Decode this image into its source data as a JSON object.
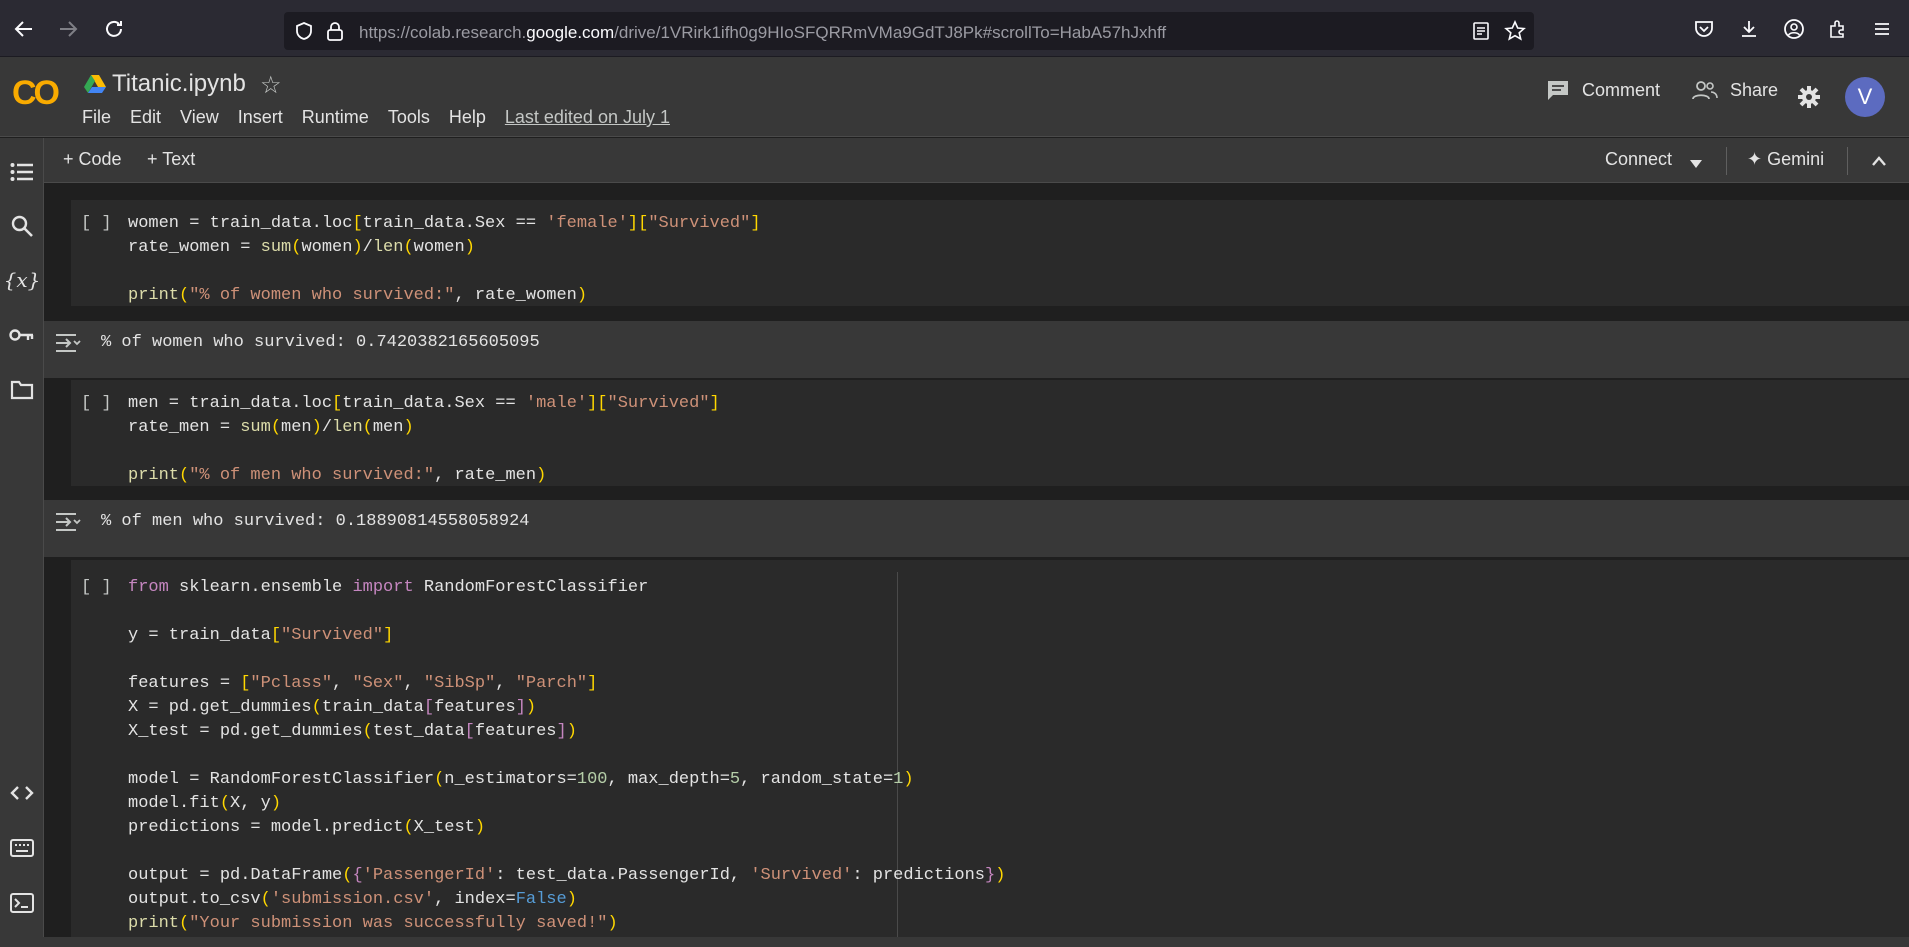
{
  "browser": {
    "url_prefix": "https://colab.research.",
    "url_domain": "google.com",
    "url_suffix": "/drive/1VRirk1ifh0g9HIoSFQRRmVMa9GdTJ8Pk#scrollTo=HabA57hJxhff"
  },
  "header": {
    "logo": "CO",
    "title": "Titanic.ipynb",
    "menu": [
      "File",
      "Edit",
      "View",
      "Insert",
      "Runtime",
      "Tools",
      "Help"
    ],
    "last_edited": "Last edited on July 1",
    "comment_label": "Comment",
    "share_label": "Share",
    "avatar_letter": "V"
  },
  "toolbar": {
    "code_label": "+ Code",
    "text_label": "+ Text",
    "connect_label": "Connect",
    "gemini_label": "✦ Gemini"
  },
  "cells": [
    {
      "bracket": "[ ]",
      "output": "% of women who survived: 0.7420382165605095"
    },
    {
      "bracket": "[ ]",
      "output": "% of men who survived: 0.18890814558058924"
    },
    {
      "bracket": "[ ]"
    }
  ],
  "colors": {
    "accent": "#f9ab00",
    "avatar": "#5c6bc0",
    "keyword": "#c586c0",
    "string": "#ce9178",
    "number": "#b5cea8",
    "bracket": "#ffd700"
  }
}
